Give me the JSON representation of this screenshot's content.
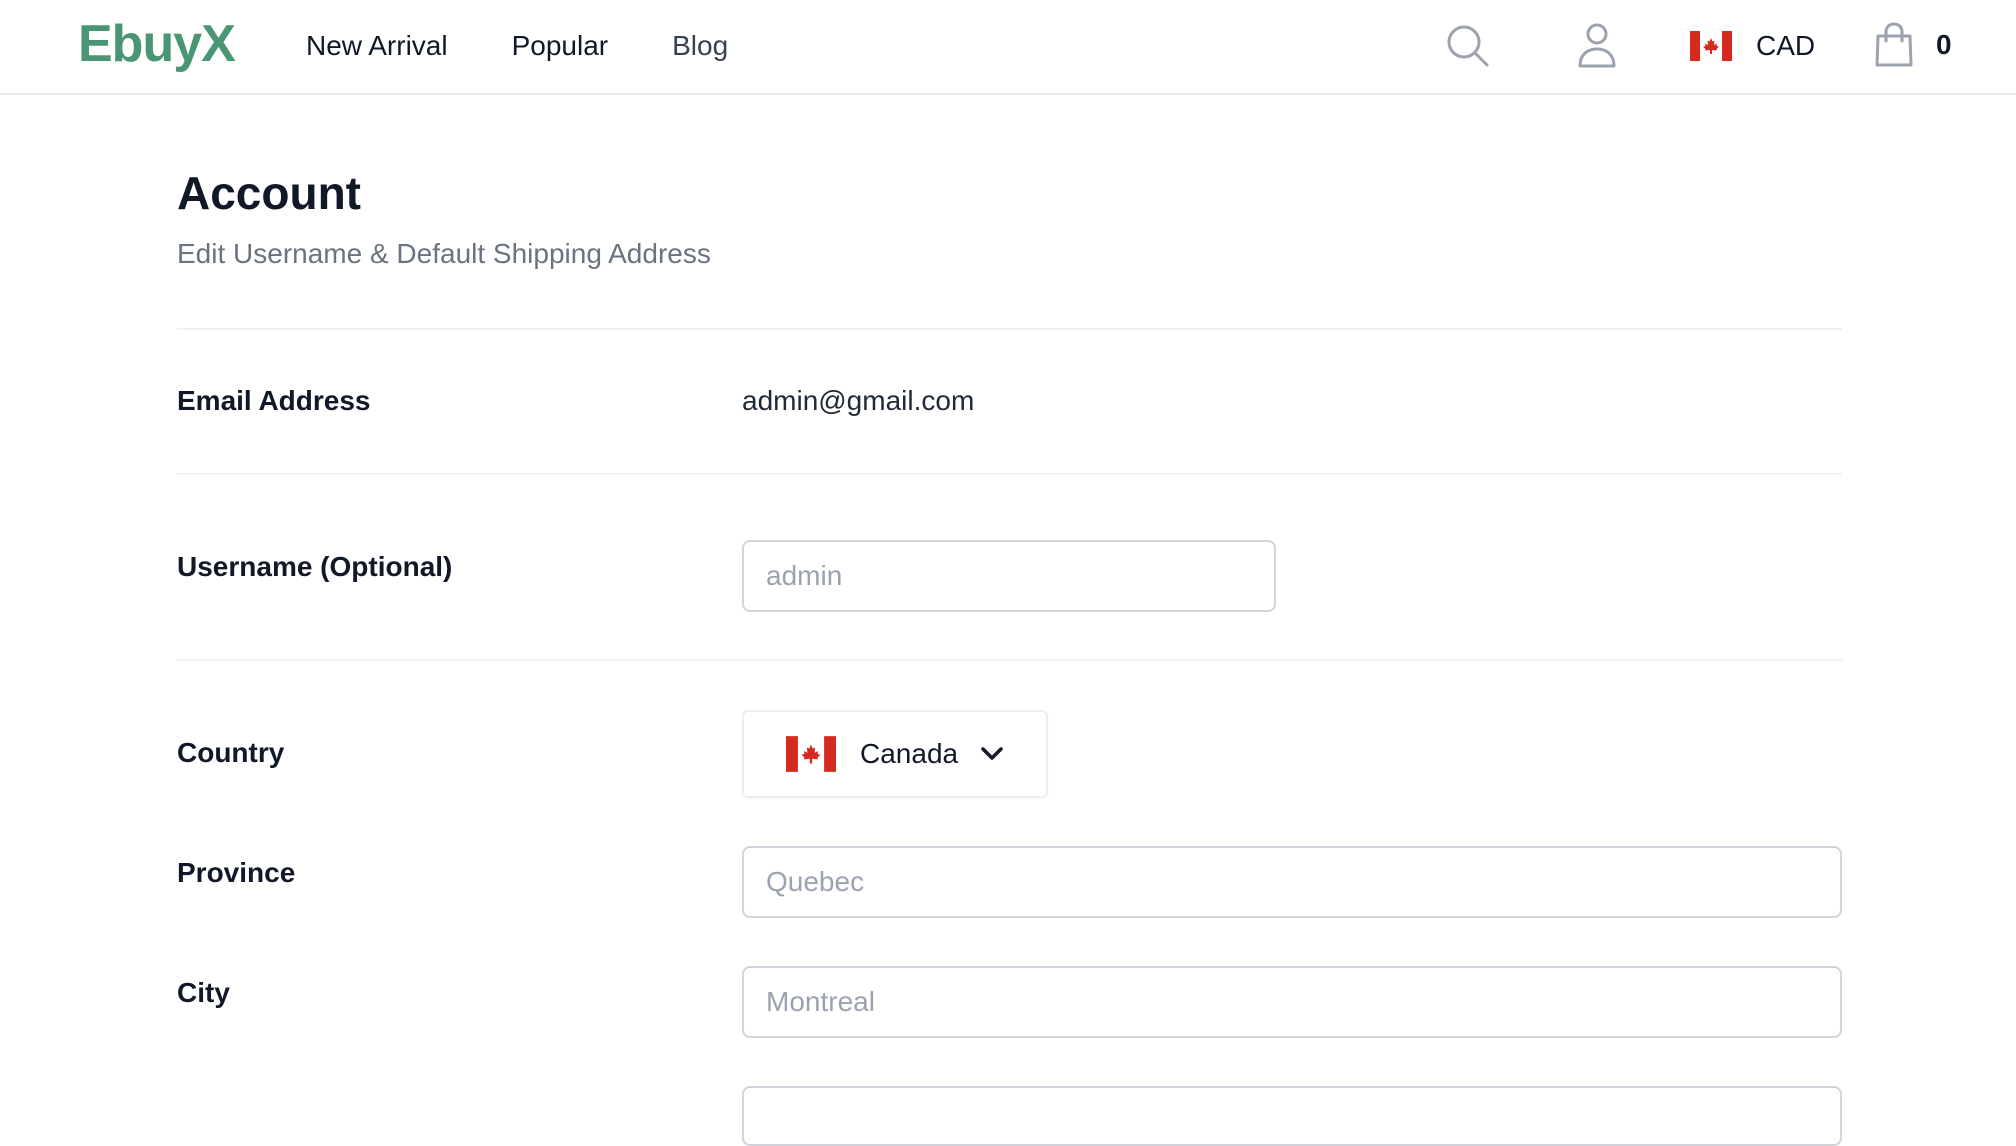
{
  "header": {
    "logo": "EbuyX",
    "nav": [
      "New Arrival",
      "Popular",
      "Blog"
    ],
    "currency": "CAD",
    "cart_count": "0"
  },
  "page": {
    "title": "Account",
    "subtitle": "Edit Username & Default Shipping Address"
  },
  "form": {
    "email_label": "Email Address",
    "email_value": "admin@gmail.com",
    "username_label": "Username (Optional)",
    "username_placeholder": "admin",
    "country_label": "Country",
    "country_value": "Canada",
    "province_label": "Province",
    "province_placeholder": "Quebec",
    "city_label": "City",
    "city_placeholder": "Montreal"
  },
  "icons": {
    "search": "search-icon",
    "user": "user-icon",
    "flag": "canada-flag-icon",
    "cart": "shopping-bag-icon",
    "chevron": "chevron-down-icon"
  },
  "colors": {
    "brand": "#4a9574",
    "flag_red": "#d52b1e"
  }
}
